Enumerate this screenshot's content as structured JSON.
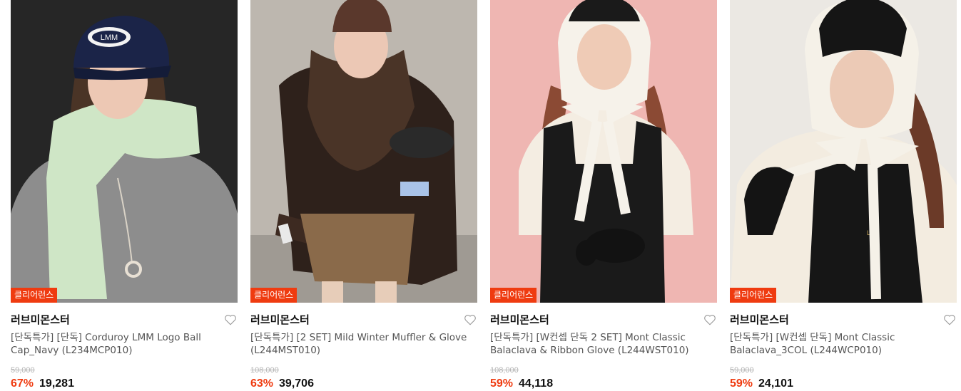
{
  "products": [
    {
      "badge": "클리어런스",
      "brand": "러브미몬스터",
      "title": "[단독특가] [단독] Corduroy LMM Logo Ball Cap_Navy (L234MCP010)",
      "original_price": "59,000",
      "discount": "67%",
      "price": "19,281",
      "cap_logo": "LMM",
      "colors": {
        "bg": "#2b2b2b",
        "accent": "#ef3b10"
      }
    },
    {
      "badge": "클리어런스",
      "brand": "러브미몬스터",
      "title": "[단독특가] [2 SET] Mild Winter Muffler & Glove (L244MST010)",
      "original_price": "108,000",
      "discount": "63%",
      "price": "39,706",
      "colors": {
        "bg": "#b9b3ab",
        "accent": "#ef3b10"
      }
    },
    {
      "badge": "클리어런스",
      "brand": "러브미몬스터",
      "title": "[단독특가] [W컨셉 단독 2 SET] Mont Classic Balaclava & Ribbon Glove (L244WST010)",
      "original_price": "108,000",
      "discount": "59%",
      "price": "44,118",
      "colors": {
        "bg": "#eeb8b4",
        "accent": "#ef3b10"
      }
    },
    {
      "badge": "클리어런스",
      "brand": "러브미몬스터",
      "title": "[단독특가] [W컨셉 단독] Mont Classic Balaclava_3COL (L244WCP010)",
      "original_price": "59,000",
      "discount": "59%",
      "price": "24,101",
      "colors": {
        "bg": "#e9e6e1",
        "accent": "#ef3b10"
      }
    }
  ],
  "icons": {
    "wishlist": "heart-outline-icon"
  }
}
